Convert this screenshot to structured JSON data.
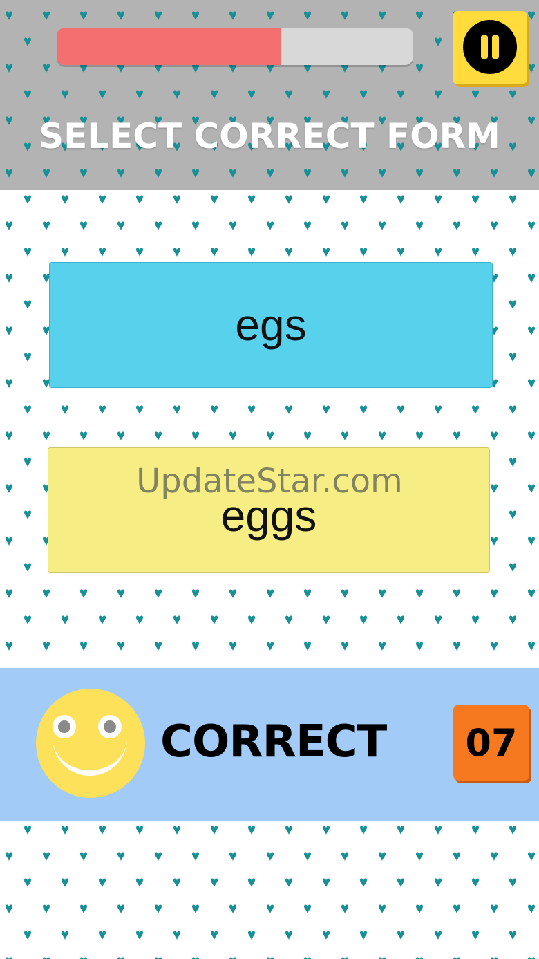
{
  "header": {
    "progress_percent": 63,
    "title": "SELECT CORRECT FORM"
  },
  "options": [
    {
      "label": "egs",
      "color": "#58d2ec"
    },
    {
      "label": "eggs",
      "color": "#f6ee84"
    }
  ],
  "watermark": "UpdateStar.com",
  "feedback": {
    "label": "CORRECT",
    "score": "07"
  },
  "icons": {
    "pause": "pause-icon",
    "smiley": "smiley-face-icon"
  },
  "colors": {
    "progress_fill": "#f36f70",
    "pause_button": "#ffdc3c",
    "score_badge": "#f7791f",
    "feedback_bar": "#a2cbf7",
    "heart_pattern": "#168f96"
  }
}
